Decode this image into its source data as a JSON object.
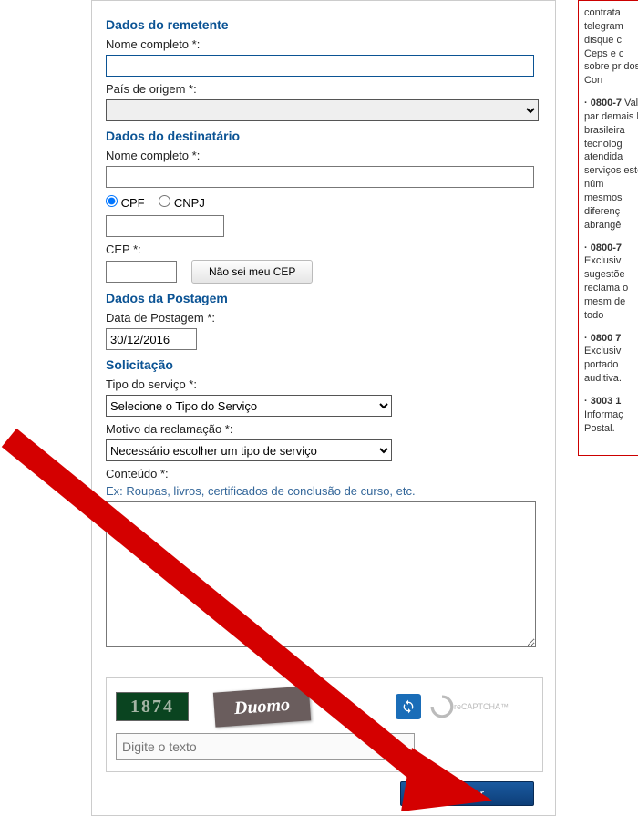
{
  "sections": {
    "sender": "Dados do remetente",
    "recipient": "Dados do destinatário",
    "posting": "Dados da Postagem",
    "request": "Solicitação"
  },
  "labels": {
    "fullname": "Nome completo *:",
    "origin_country": "País de origem *:",
    "cpf": "CPF",
    "cnpj": "CNPJ",
    "cep": "CEP *:",
    "cep_unknown": "Não sei meu CEP",
    "posting_date": "Data de Postagem *:",
    "service_type": "Tipo do serviço *:",
    "complaint_reason": "Motivo da reclamação *:",
    "content": "Conteúdo *:"
  },
  "values": {
    "posting_date": "30/12/2016",
    "service_type_placeholder": "Selecione o Tipo do Serviço",
    "complaint_reason_placeholder": "Necessário escolher um tipo de serviço",
    "content_hint": "Ex: Roupas, livros, certificados de conclusão de curso, etc."
  },
  "captcha": {
    "word1": "1874",
    "word2": "Duomo",
    "placeholder": "Digite o texto",
    "brand": "reCAPTCHA™"
  },
  "buttons": {
    "submit": "Enviar"
  },
  "sidebar": {
    "intro": "contrata telegram disque c Ceps e c sobre pr dos Corr",
    "items": [
      {
        "phone": "· 0800-7",
        "text": "Vale par demais l brasileira tecnolog atendida serviços este núm mesmos diferenç abrangê"
      },
      {
        "phone": "· 0800-7",
        "text": "Exclusiv sugestõe reclama o mesm de todo"
      },
      {
        "phone": "· 0800 7",
        "text": "Exclusiv portado auditiva."
      },
      {
        "phone": "· 3003 1",
        "text": "Informaç Postal."
      }
    ]
  }
}
